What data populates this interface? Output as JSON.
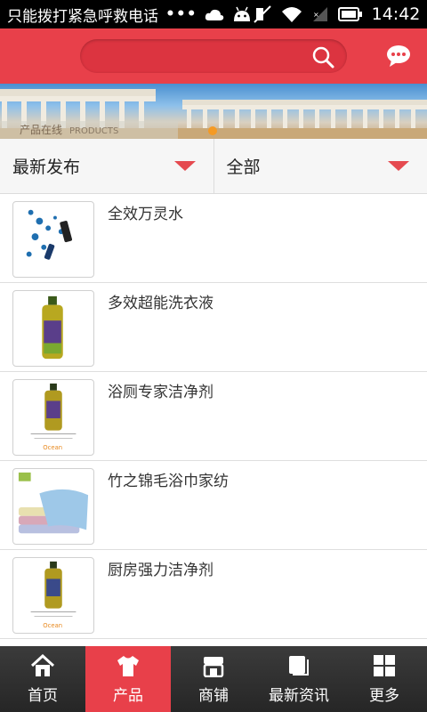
{
  "status_bar": {
    "notification_text": "只能拨打紧急呼救电话",
    "dots": "•••",
    "time": "14:42"
  },
  "header": {
    "search_placeholder": ""
  },
  "banner": {
    "label_cn": "产品在线",
    "label_en": "PRODUCTS"
  },
  "filters": {
    "sort_label": "最新发布",
    "category_label": "全部"
  },
  "products": [
    {
      "title": "全效万灵水"
    },
    {
      "title": "多效超能洗衣液"
    },
    {
      "title": "浴厕专家洁净剂"
    },
    {
      "title": "竹之锦毛浴巾家纺"
    },
    {
      "title": "厨房强力洁净剂"
    }
  ],
  "bottom_nav": [
    {
      "label": "首页",
      "icon": "home-icon"
    },
    {
      "label": "产品",
      "icon": "shirt-icon"
    },
    {
      "label": "商铺",
      "icon": "shop-icon"
    },
    {
      "label": "最新资讯",
      "icon": "news-icon"
    },
    {
      "label": "更多",
      "icon": "grid-icon"
    }
  ],
  "colors": {
    "brand_red": "#e8404a",
    "accent_orange": "#f59a23"
  }
}
